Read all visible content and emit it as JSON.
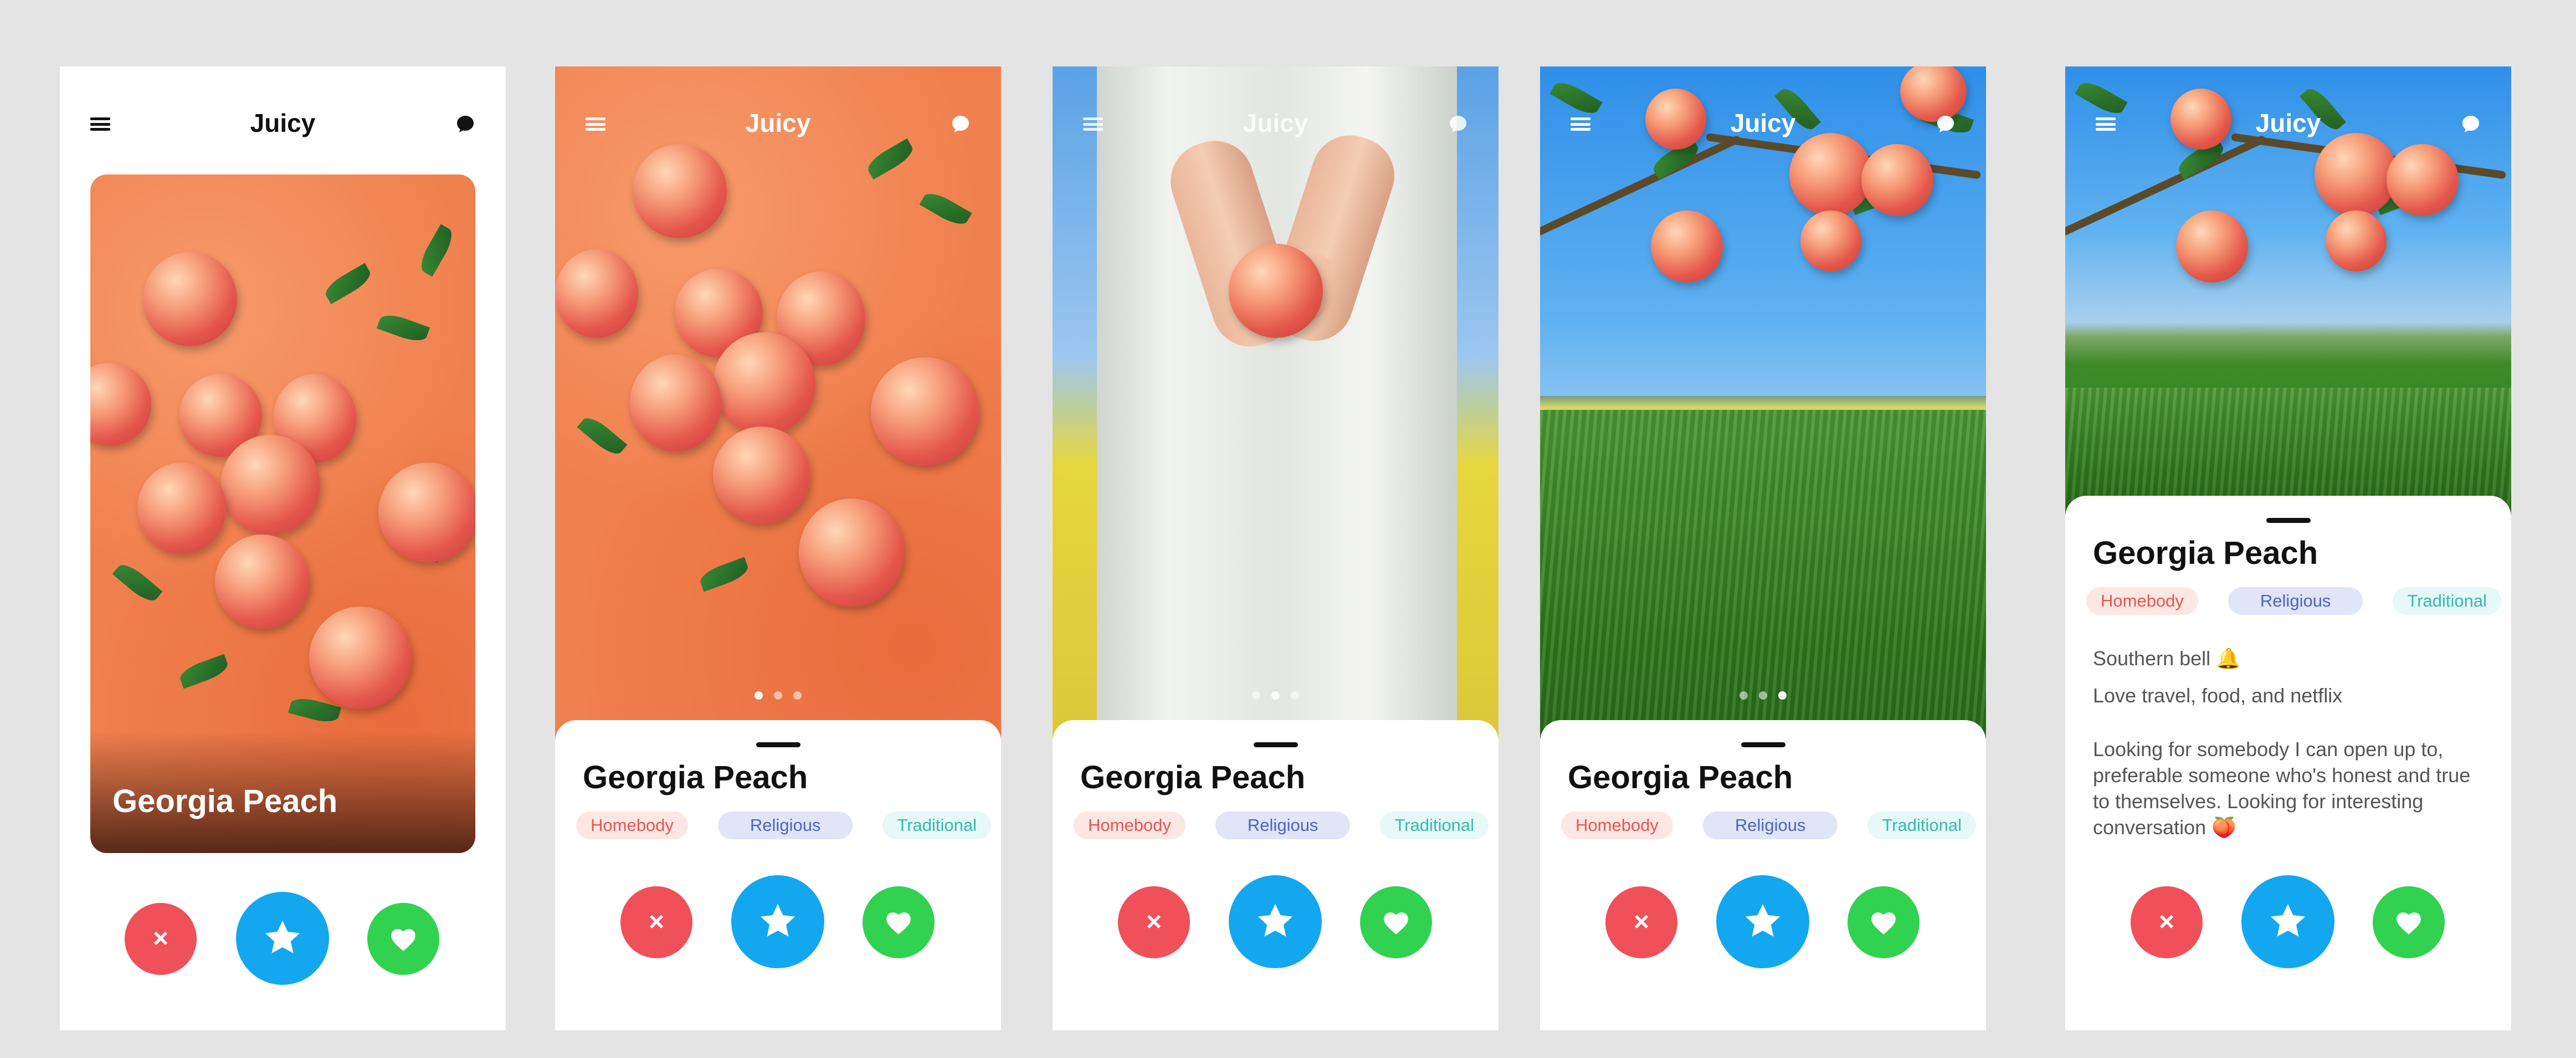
{
  "app": {
    "title": "Juicy"
  },
  "profile": {
    "name": "Georgia Peach",
    "tags": [
      "Homebody",
      "Religious",
      "Traditional"
    ],
    "bio": {
      "line1": "Southern bell 🔔",
      "line2": "Love travel, food, and netflix",
      "line3": "Looking for somebody I can open up to, preferable someone who's honest and true to themselves. Looking for interesting conversation 🍑"
    }
  },
  "photo_carousel": {
    "total": 3
  },
  "icons": {
    "menu": "hamburger-menu-icon",
    "chat": "chat-bubble-icon",
    "dislike": "close-x-icon",
    "superlike": "star-icon",
    "like": "heart-icon"
  },
  "actions": {
    "dislike_label": "×"
  },
  "colors": {
    "dislike": "#f0505a",
    "superlike": "#13a7ef",
    "like": "#31d24f",
    "tag_homebody": "#e5574d",
    "tag_religious": "#4c63c4",
    "tag_traditional": "#34b9b0",
    "background": "#e4e4e4"
  },
  "screens": [
    {
      "id": "card-view"
    },
    {
      "id": "profile-photo-1",
      "active_photo": 1
    },
    {
      "id": "profile-photo-2",
      "active_photo": 2
    },
    {
      "id": "profile-photo-3",
      "active_photo": 3
    },
    {
      "id": "profile-expanded"
    }
  ]
}
